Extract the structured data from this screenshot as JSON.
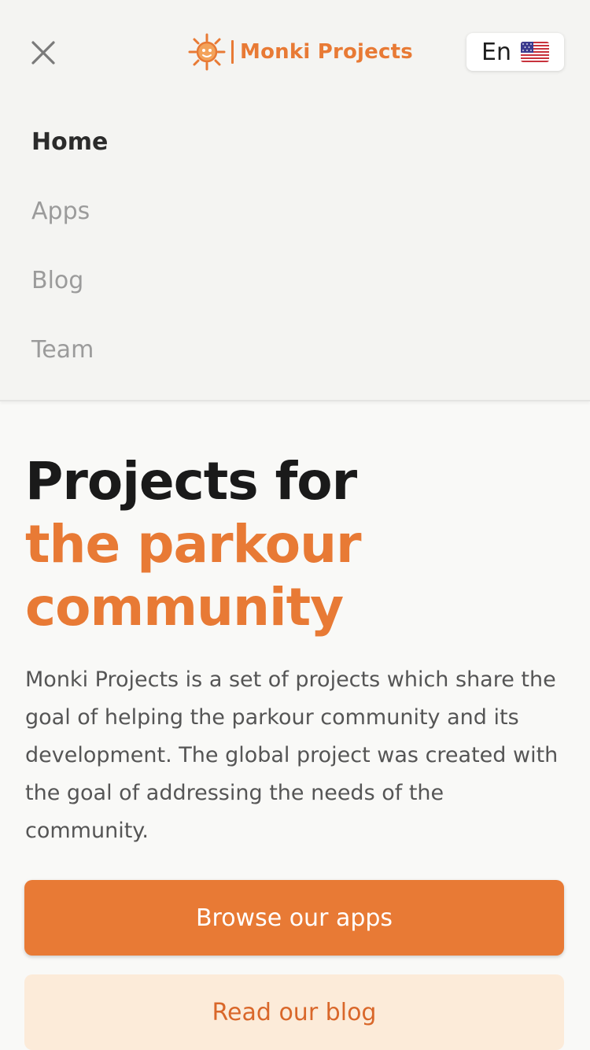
{
  "header": {
    "brand_name": "Monki Projects",
    "language_code": "En",
    "flag": "us-flag-icon",
    "close_icon": "close-icon",
    "logo_icon": "monki-logo-icon"
  },
  "nav": {
    "items": [
      {
        "label": "Home",
        "active": true
      },
      {
        "label": "Apps",
        "active": false
      },
      {
        "label": "Blog",
        "active": false
      },
      {
        "label": "Team",
        "active": false
      }
    ]
  },
  "hero": {
    "title_line1": "Projects for",
    "title_accent_line1": "the parkour",
    "title_accent_line2": "community",
    "description": "Monki Projects is a set of projects which share the goal of helping the parkour community and its development. The global project was created with the goal of addressing the needs of the community."
  },
  "actions": {
    "primary_label": "Browse our apps",
    "secondary_label": "Read our blog"
  },
  "colors": {
    "accent": "#e87a35",
    "accent_light": "#fcebd9",
    "background": "#f9f9f7",
    "menu_background": "#f4f4f2",
    "text_dark": "#1a1a1a",
    "text_muted": "#9b9b9b"
  }
}
